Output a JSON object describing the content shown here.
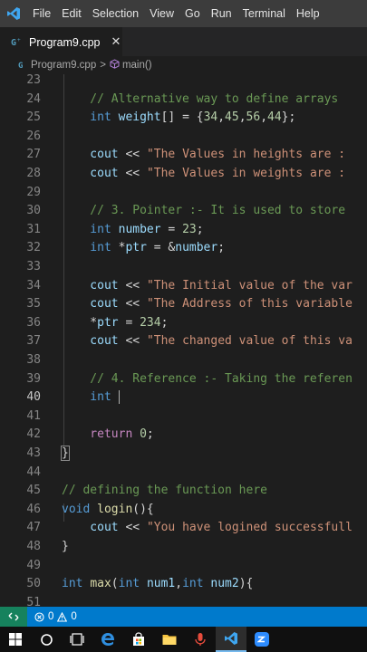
{
  "menu": {
    "items": [
      "File",
      "Edit",
      "Selection",
      "View",
      "Go",
      "Run",
      "Terminal",
      "Help"
    ]
  },
  "tab": {
    "label": "Program9.cpp",
    "close_glyph": "✕"
  },
  "breadcrumb": {
    "file": "Program9.cpp",
    "separator": ">",
    "symbol": "main()"
  },
  "editor": {
    "active_line": 40,
    "lines": [
      {
        "n": "23",
        "tokens": []
      },
      {
        "n": "24",
        "tokens": [
          [
            "cm",
            "    // Alternative way to define arrays"
          ]
        ]
      },
      {
        "n": "25",
        "tokens": [
          [
            "ty",
            "    int "
          ],
          [
            "var",
            "weight"
          ],
          [
            "op",
            "[] = {"
          ],
          [
            "num",
            "34"
          ],
          [
            "op",
            ","
          ],
          [
            "num",
            "45"
          ],
          [
            "op",
            ","
          ],
          [
            "num",
            "56"
          ],
          [
            "op",
            ","
          ],
          [
            "num",
            "44"
          ],
          [
            "op",
            "};"
          ]
        ]
      },
      {
        "n": "26",
        "tokens": []
      },
      {
        "n": "27",
        "tokens": [
          [
            "var",
            "    cout"
          ],
          [
            "op",
            " << "
          ],
          [
            "str",
            "\"The Values in heights are : "
          ]
        ]
      },
      {
        "n": "28",
        "tokens": [
          [
            "var",
            "    cout"
          ],
          [
            "op",
            " << "
          ],
          [
            "str",
            "\"The Values in weights are : "
          ]
        ]
      },
      {
        "n": "29",
        "tokens": []
      },
      {
        "n": "30",
        "tokens": [
          [
            "cm",
            "    // 3. Pointer :- It is used to store"
          ]
        ]
      },
      {
        "n": "31",
        "tokens": [
          [
            "ty",
            "    int "
          ],
          [
            "var",
            "number"
          ],
          [
            "op",
            " = "
          ],
          [
            "num",
            "23"
          ],
          [
            "op",
            ";"
          ]
        ]
      },
      {
        "n": "32",
        "tokens": [
          [
            "ty",
            "    int "
          ],
          [
            "op",
            "*"
          ],
          [
            "var",
            "ptr"
          ],
          [
            "op",
            " = &"
          ],
          [
            "var",
            "number"
          ],
          [
            "op",
            ";"
          ]
        ]
      },
      {
        "n": "33",
        "tokens": []
      },
      {
        "n": "34",
        "tokens": [
          [
            "var",
            "    cout"
          ],
          [
            "op",
            " << "
          ],
          [
            "str",
            "\"The Initial value of the var"
          ]
        ]
      },
      {
        "n": "35",
        "tokens": [
          [
            "var",
            "    cout"
          ],
          [
            "op",
            " << "
          ],
          [
            "str",
            "\"The Address of this variable"
          ]
        ]
      },
      {
        "n": "36",
        "tokens": [
          [
            "op",
            "    *"
          ],
          [
            "var",
            "ptr"
          ],
          [
            "op",
            " = "
          ],
          [
            "num",
            "234"
          ],
          [
            "op",
            ";"
          ]
        ]
      },
      {
        "n": "37",
        "tokens": [
          [
            "var",
            "    cout"
          ],
          [
            "op",
            " << "
          ],
          [
            "str",
            "\"The changed value of this va"
          ]
        ]
      },
      {
        "n": "38",
        "tokens": []
      },
      {
        "n": "39",
        "tokens": [
          [
            "cm",
            "    // 4. Reference :- Taking the referen"
          ]
        ]
      },
      {
        "n": "40",
        "tokens": [
          [
            "ty",
            "    int "
          ]
        ],
        "cursor": true
      },
      {
        "n": "41",
        "tokens": []
      },
      {
        "n": "42",
        "tokens": [
          [
            "ctl",
            "    return "
          ],
          [
            "num",
            "0"
          ],
          [
            "op",
            ";"
          ]
        ]
      },
      {
        "n": "43",
        "tokens": [
          [
            "op",
            "}"
          ]
        ],
        "bracket": true
      },
      {
        "n": "44",
        "tokens": []
      },
      {
        "n": "45",
        "tokens": [
          [
            "cm",
            "// defining the function here"
          ]
        ]
      },
      {
        "n": "46",
        "tokens": [
          [
            "ty",
            "void "
          ],
          [
            "fn",
            "login"
          ],
          [
            "op",
            "(){"
          ]
        ]
      },
      {
        "n": "47",
        "tokens": [
          [
            "var",
            "    cout"
          ],
          [
            "op",
            " << "
          ],
          [
            "str",
            "\"You have logined successfull"
          ]
        ]
      },
      {
        "n": "48",
        "tokens": [
          [
            "op",
            "}"
          ]
        ]
      },
      {
        "n": "49",
        "tokens": []
      },
      {
        "n": "50",
        "tokens": [
          [
            "ty",
            "int "
          ],
          [
            "fn",
            "max"
          ],
          [
            "op",
            "("
          ],
          [
            "ty",
            "int "
          ],
          [
            "var",
            "num1"
          ],
          [
            "op",
            ","
          ],
          [
            "ty",
            "int "
          ],
          [
            "var",
            "num2"
          ],
          [
            "op",
            "){"
          ]
        ]
      },
      {
        "n": "51",
        "tokens": []
      }
    ]
  },
  "status": {
    "errors": "0",
    "warnings": "0"
  },
  "taskbar": {
    "icons": [
      "windows-start-icon",
      "search-icon",
      "task-view-icon",
      "edge-icon",
      "store-icon",
      "file-explorer-icon",
      "microphone-icon",
      "vscode-icon",
      "zoom-icon"
    ],
    "active": "vscode-icon"
  },
  "colors": {
    "menubar": "#3c3c3c",
    "editor_bg": "#1e1e1e",
    "statusbar": "#007acc",
    "remote": "#16825d",
    "keyword": "#569cd6",
    "string": "#ce9178",
    "comment": "#6a9955",
    "number": "#b5cea8"
  }
}
